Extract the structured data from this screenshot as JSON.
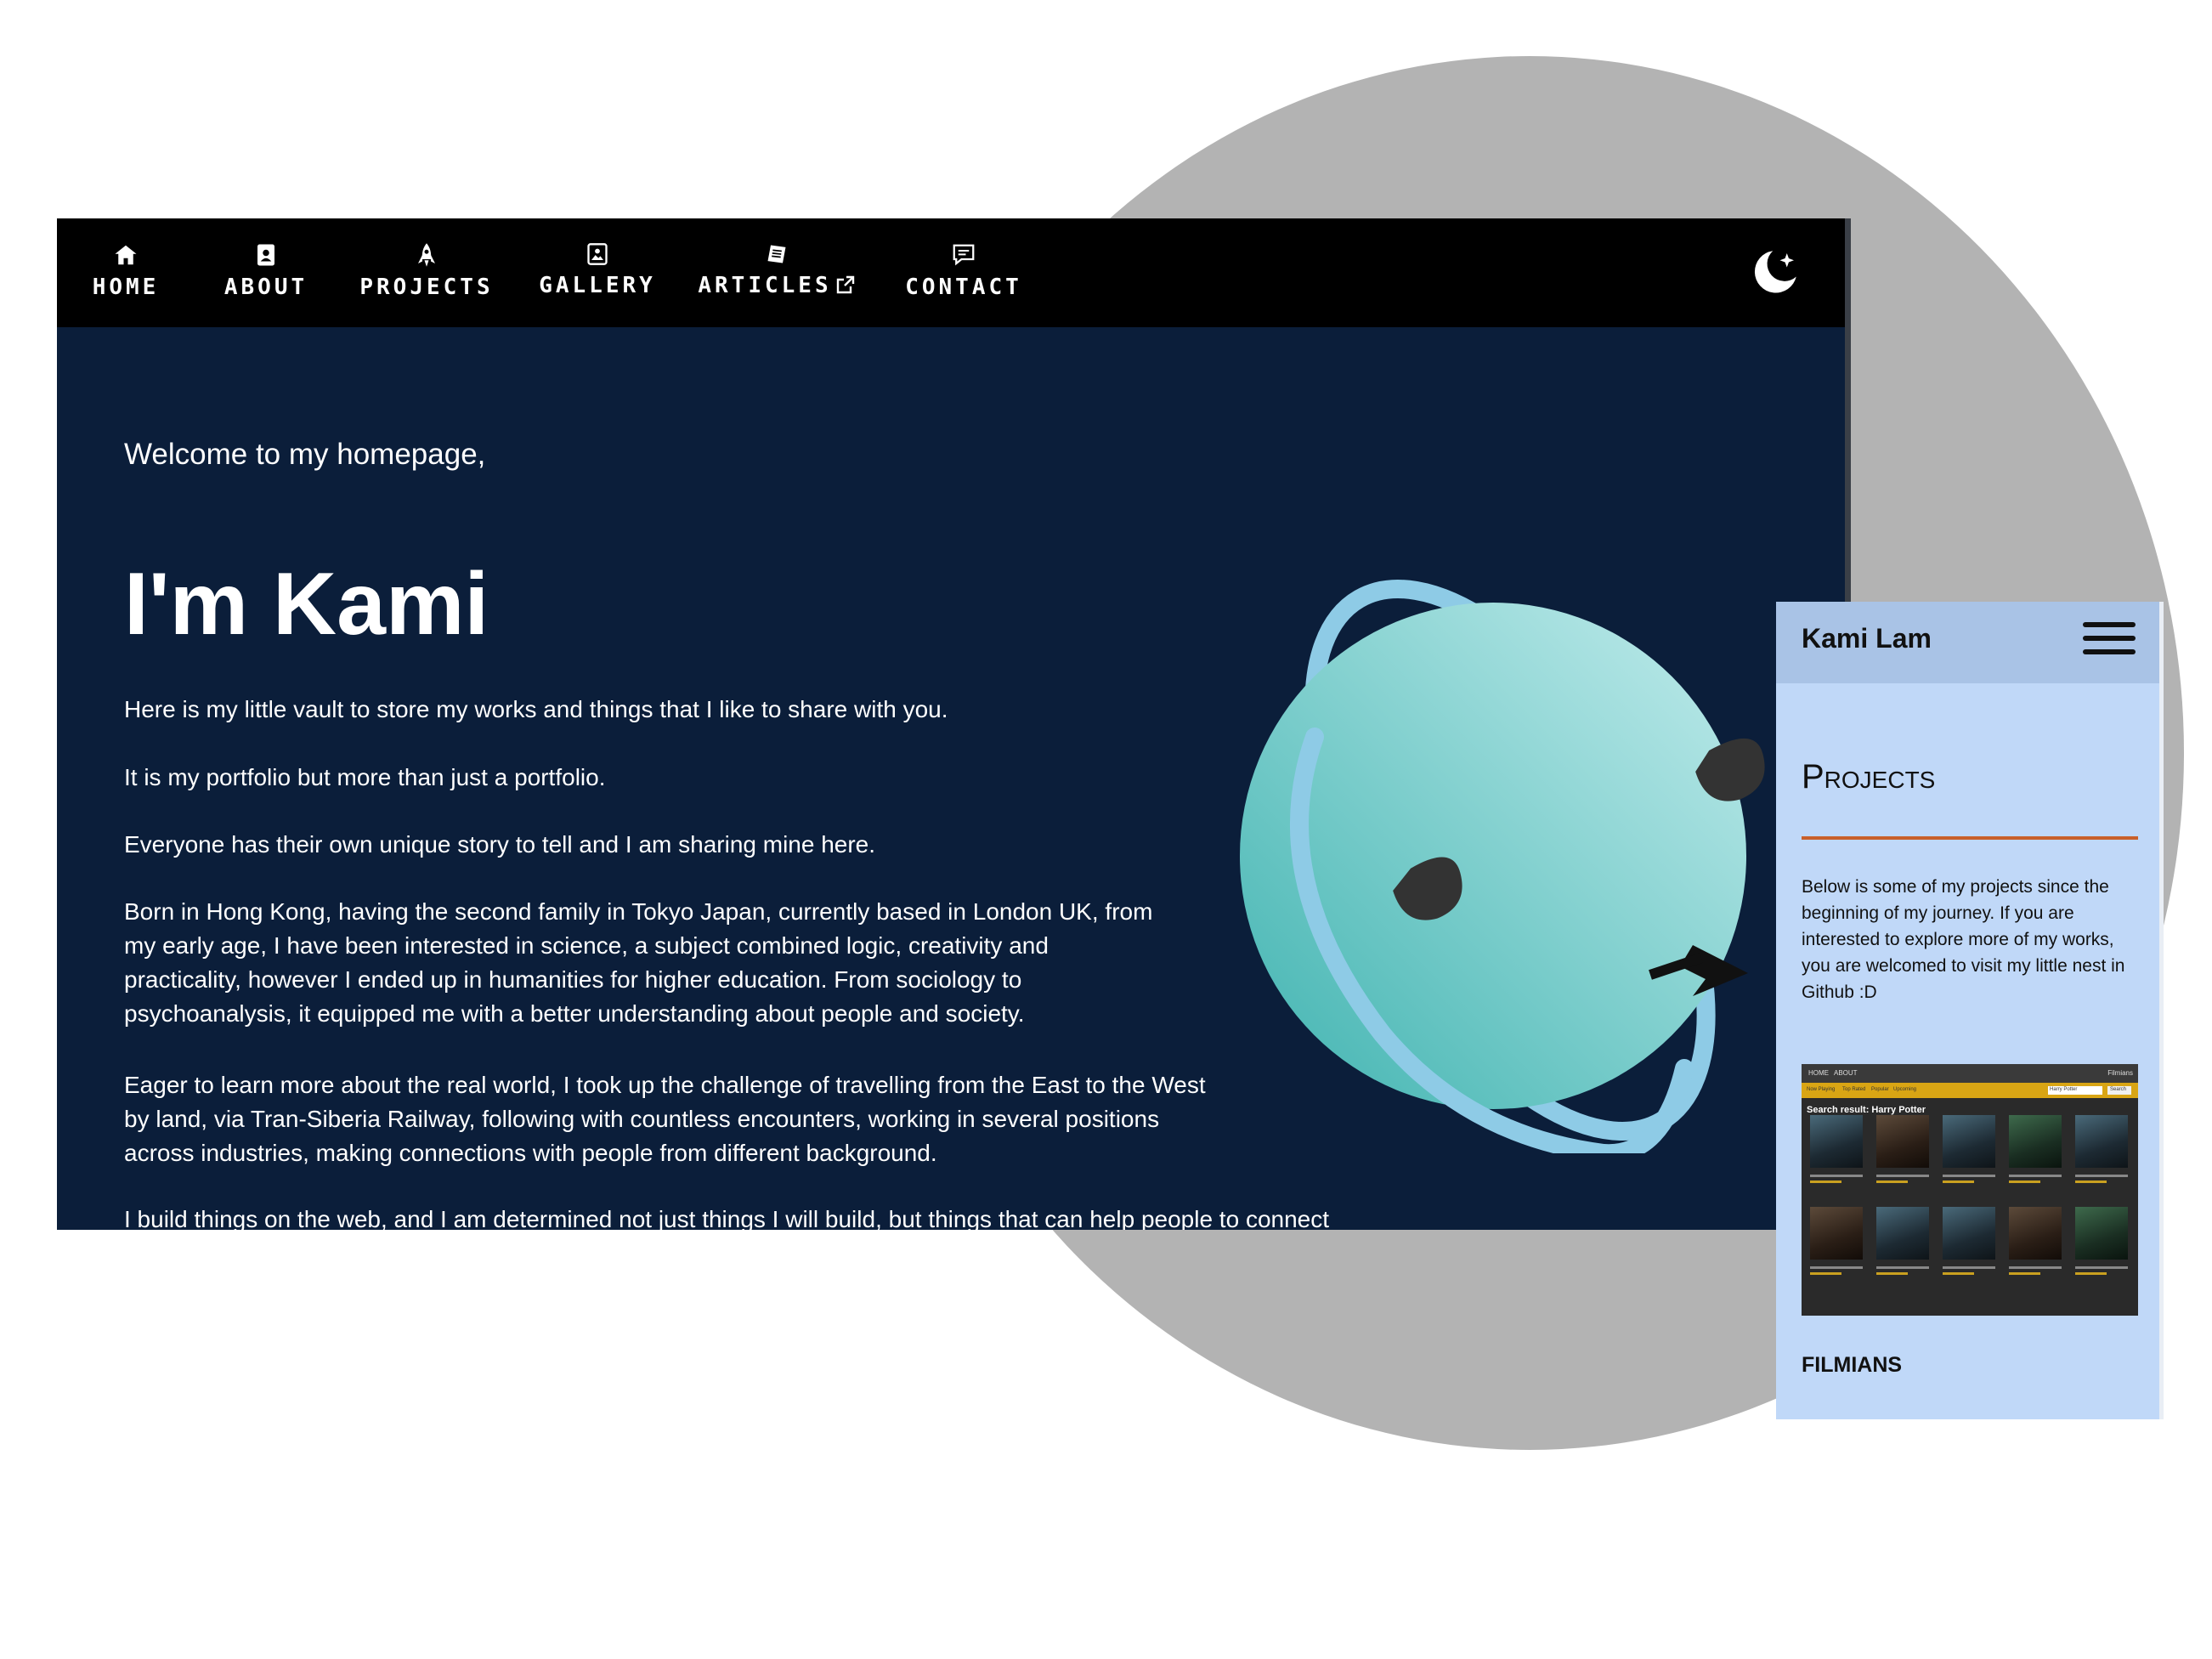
{
  "desktop": {
    "nav": {
      "items": [
        {
          "label": "HOME",
          "icon": "home-icon"
        },
        {
          "label": "ABOUT",
          "icon": "contact-card-icon"
        },
        {
          "label": "PROJECTS",
          "icon": "rocket-icon"
        },
        {
          "label": "GALLERY",
          "icon": "image-icon"
        },
        {
          "label": "ARTICLES",
          "icon": "newspaper-icon",
          "trailing_icon": "external-link-icon"
        },
        {
          "label": "CONTACT",
          "icon": "chat-icon"
        }
      ],
      "theme_toggle_icon": "moon-stars-icon"
    },
    "hero": {
      "welcome": "Welcome to my homepage,",
      "name": "I'm Kami",
      "paragraphs": [
        "Here is my little vault to store my works and things that I like to share with you.",
        "It is my portfolio but more than just a portfolio.",
        "Everyone has their own unique story to tell and I am sharing mine here.",
        "Born in Hong Kong, having the second family in Tokyo Japan, currently based in London UK, from my early age, I have been interested in science, a subject combined logic, creativity and practicality, however I ended up in humanities for higher education. From sociology to psychoanalysis, it equipped me with a better understanding about people and society.",
        "Eager to learn more about the real world, I took up the challenge of travelling from the East to the West by land, via Tran-Siberia Railway, following with countless encounters, working in several positions across industries, making connections with people from different background.",
        "I build things on the web, and I am determined not just things I will build, but things that can help people to connect"
      ],
      "illustration": "sleepy-planet-illustration"
    },
    "colors": {
      "nav_bg": "#000000",
      "page_bg": "#0b1e3a",
      "planet": "#6cc6c4",
      "ring": "#8ecbe6"
    }
  },
  "mobile": {
    "brand": "Kami Lam",
    "menu_icon": "hamburger-icon",
    "section_title": "Projects",
    "description": "Below is some of my projects since the beginning of my journey. If you are interested to explore more of my works, you are welcomed to visit my little nest in Github :D",
    "project": {
      "screenshot": {
        "top_links": [
          "HOME",
          "ABOUT"
        ],
        "brand": "Filmians",
        "tabs": [
          "Now Playing",
          "Top Rated",
          "Popular",
          "Upcoming"
        ],
        "search_value": "Harry Potter",
        "search_button": "Search",
        "result_title": "Search result: Harry Potter"
      },
      "name": "FILMIANS"
    },
    "colors": {
      "bg": "#c0d8f8",
      "header_bg": "#a9c3e6",
      "rule": "#c9602a"
    }
  }
}
